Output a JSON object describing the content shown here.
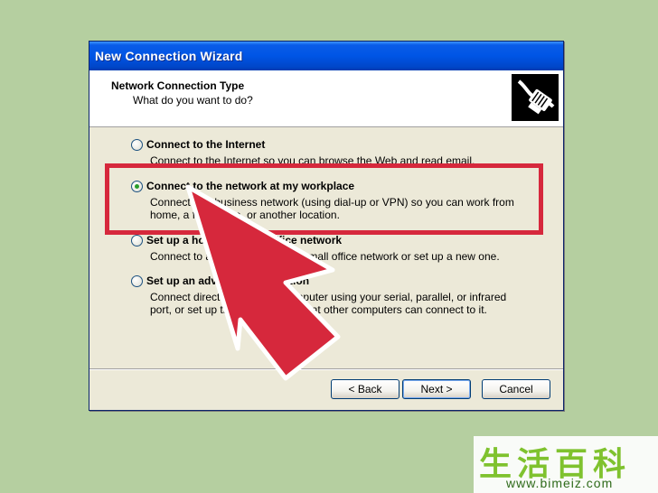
{
  "window": {
    "title": "New Connection Wizard"
  },
  "header": {
    "title": "Network Connection Type",
    "subtitle": "What do you want to do?",
    "icon": "network-cable-icon"
  },
  "options": [
    {
      "label": "Connect to the Internet",
      "description": "Connect to the Internet so you can browse the Web and read email.",
      "selected": false
    },
    {
      "label": "Connect to the network at my workplace",
      "description": "Connect to a business network (using dial-up or VPN) so you can work from home, a field office, or another location.",
      "selected": true
    },
    {
      "label": "Set up a home or small office network",
      "description": "Connect to an existing home or small office network or set up a new one.",
      "selected": false
    },
    {
      "label": "Set up an advanced connection",
      "description": "Connect directly to another computer using your serial, parallel, or infrared port, or set up this computer so that other computers can connect to it.",
      "selected": false
    }
  ],
  "buttons": {
    "back": "< Back",
    "next": "Next >",
    "cancel": "Cancel"
  },
  "annotation": {
    "highlight_color": "#d6283c",
    "arrow_color": "#d6283c"
  },
  "watermark": {
    "glyphs": "生活百科",
    "url": "www.bimeiz.com"
  }
}
